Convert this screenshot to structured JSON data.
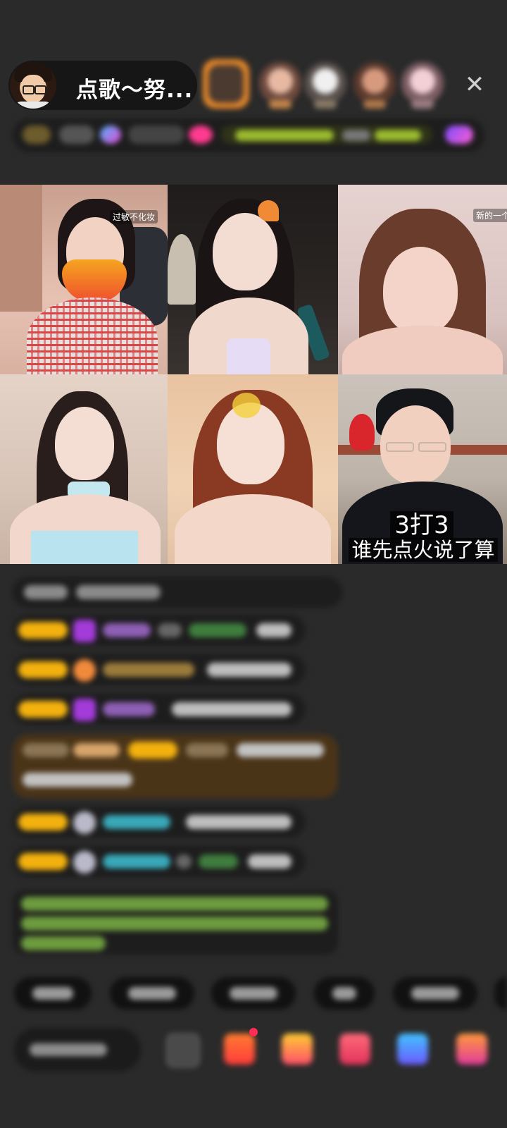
{
  "header": {
    "host_title": "点歌～努...",
    "close_symbol": "✕"
  },
  "video_grid": {
    "tiles": [
      {
        "tag": "过敏不化妆"
      },
      {
        "tag": ""
      },
      {
        "tag": "新的一个月"
      },
      {
        "tag": ""
      },
      {
        "tag": ""
      },
      {
        "tag": ""
      }
    ],
    "overlay": {
      "line1": "3打3",
      "line2": "谁先点火说了算"
    }
  },
  "colors": {
    "background": "#2a2a2a",
    "level_badge": "#f3b10e",
    "purple_heart": "#a23bd9",
    "orange_heart": "#f28a3b",
    "teal_name": "#39a8b8",
    "green_text": "#8bc34a"
  },
  "icons": {
    "close": "close-icon",
    "heart": "heart-icon",
    "gift": "gift-icon",
    "emoji": "emoji-icon"
  }
}
